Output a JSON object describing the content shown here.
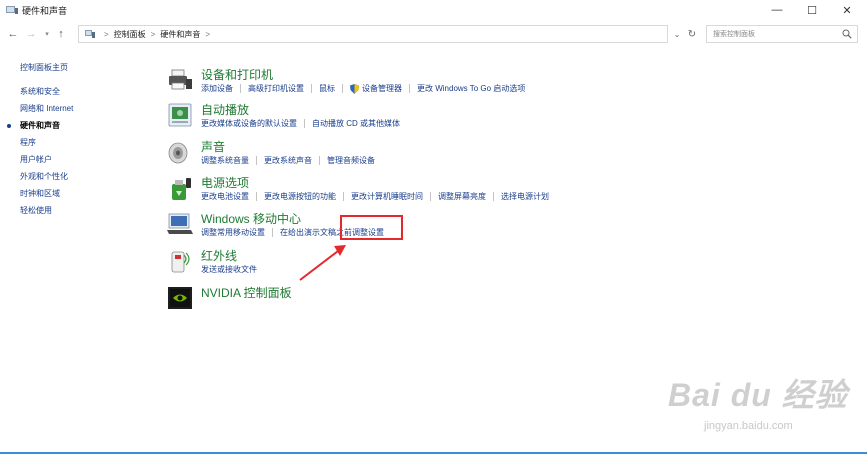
{
  "window": {
    "title": "硬件和声音",
    "minimize_glyph": "—",
    "maximize_glyph": "☐",
    "close_glyph": "✕"
  },
  "nav": {
    "back_glyph": "←",
    "forward_glyph": "→",
    "history_glyph": "▾",
    "up_glyph": "↑",
    "breadcrumb": [
      "控制面板",
      "硬件和声音"
    ],
    "crumb_separator": ">",
    "address_dropdown_glyph": "⌄",
    "refresh_glyph": "↻",
    "search_placeholder": "搜索控制面板"
  },
  "sidebar": {
    "home": "控制面板主页",
    "items": [
      {
        "label": "系统和安全",
        "active": false
      },
      {
        "label": "网络和 Internet",
        "active": false
      },
      {
        "label": "硬件和声音",
        "active": true
      },
      {
        "label": "程序",
        "active": false
      },
      {
        "label": "用户帐户",
        "active": false
      },
      {
        "label": "外观和个性化",
        "active": false
      },
      {
        "label": "时钟和区域",
        "active": false
      },
      {
        "label": "轻松使用",
        "active": false
      }
    ]
  },
  "categories": [
    {
      "title": "设备和打印机",
      "icon": "printer-icon",
      "links": [
        "添加设备",
        "高级打印机设置",
        "鼠标",
        "设备管理器",
        "更改 Windows To Go 启动选项"
      ]
    },
    {
      "title": "自动播放",
      "icon": "autoplay-icon",
      "links": [
        "更改媒体或设备的默认设置",
        "自动播放 CD 或其他媒体"
      ]
    },
    {
      "title": "声音",
      "icon": "speaker-icon",
      "links": [
        "调整系统音量",
        "更改系统声音",
        "管理音频设备"
      ]
    },
    {
      "title": "电源选项",
      "icon": "power-icon",
      "links": [
        "更改电池设置",
        "更改电源按钮的功能",
        "更改计算机睡眠时间",
        "调整屏幕亮度",
        "选择电源计划"
      ]
    },
    {
      "title": "Windows 移动中心",
      "icon": "mobility-center-icon",
      "links": [
        "调整常用移动设置",
        "在给出演示文稿之前调整设置"
      ]
    },
    {
      "title": "红外线",
      "icon": "infrared-icon",
      "links": [
        "发送或接收文件"
      ]
    },
    {
      "title": "NVIDIA 控制面板",
      "icon": "nvidia-icon",
      "links": []
    }
  ],
  "watermark": {
    "logo": "Bai du 经验",
    "url": "jingyan.baidu.com"
  },
  "colors": {
    "title_green": "#1f7a33",
    "link_blue": "#1a3e8c",
    "highlight_red": "#e5282c"
  }
}
